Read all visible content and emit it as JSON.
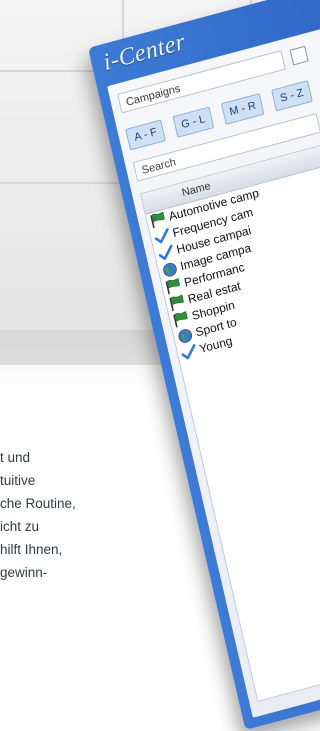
{
  "app": {
    "title": "i-Center"
  },
  "campaigns_header": {
    "label": "Campaigns"
  },
  "filters": [
    {
      "label": "A - F"
    },
    {
      "label": "G - L"
    },
    {
      "label": "M - R"
    },
    {
      "label": "S - Z"
    }
  ],
  "search": {
    "placeholder": "Search"
  },
  "list": {
    "column_name": "Name",
    "rows": [
      {
        "label": "Automotive camp",
        "icon": "flag-icon"
      },
      {
        "label": "Frequency cam",
        "icon": "check-icon"
      },
      {
        "label": "House campai",
        "icon": "check-icon"
      },
      {
        "label": "Image campa",
        "icon": "globe-icon"
      },
      {
        "label": "Performanc",
        "icon": "flag-icon"
      },
      {
        "label": "Real estat",
        "icon": "flag-icon"
      },
      {
        "label": "Shoppin",
        "icon": "flag-icon"
      },
      {
        "label": "Sport to",
        "icon": "globe-icon"
      },
      {
        "label": "Young",
        "icon": "check-icon"
      }
    ]
  },
  "body_copy": {
    "lines": [
      "t und",
      "tuitive",
      "che Routine,",
      "icht zu",
      "hilft Ihnen,",
      " gewinn-"
    ]
  },
  "colors": {
    "window_blue": "#3d7bd6",
    "flag_green": "#2f8f3a",
    "check_blue": "#2a7ad6"
  }
}
